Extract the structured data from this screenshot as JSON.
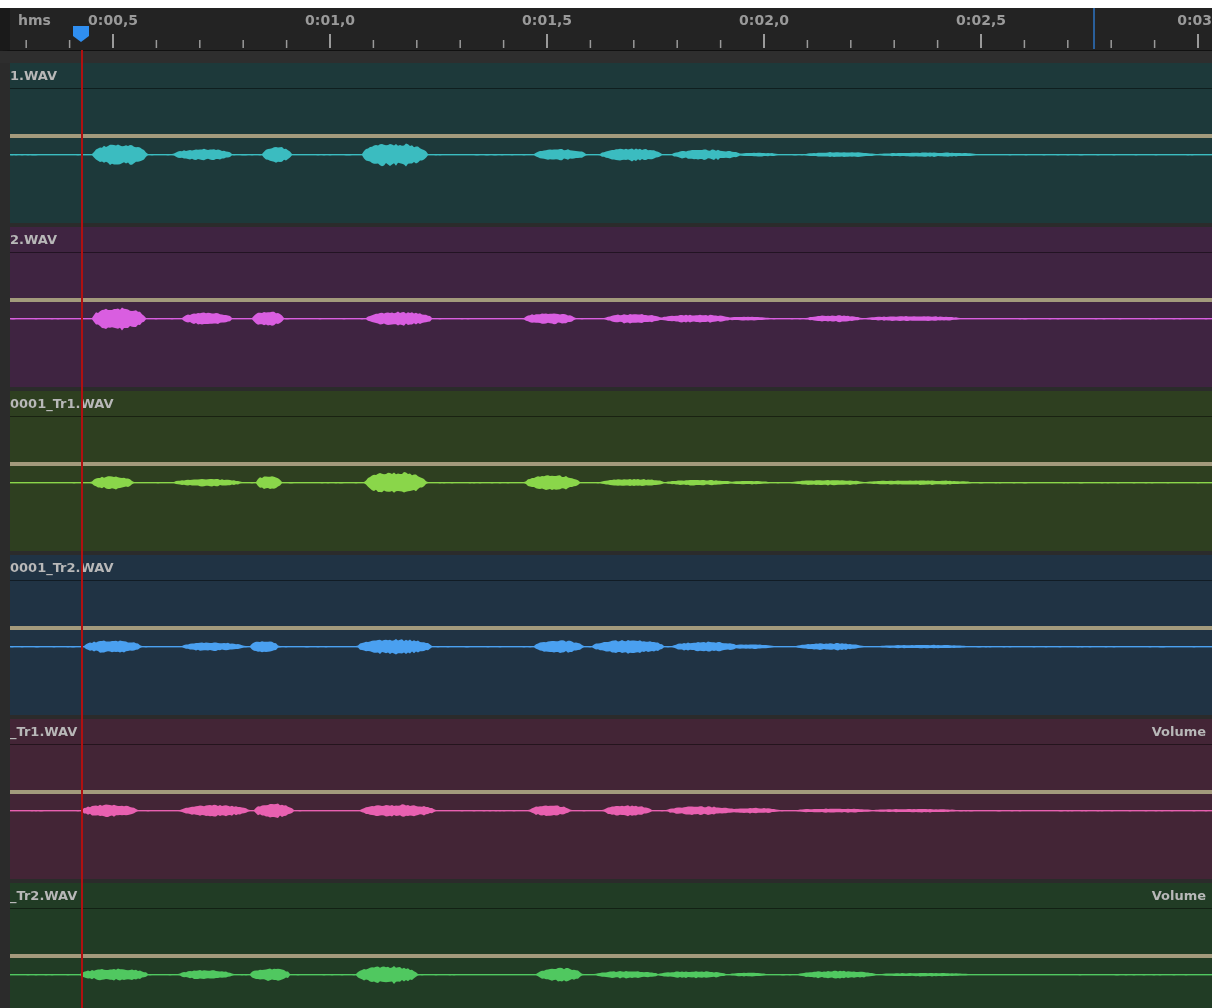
{
  "ruler": {
    "unit": "hms",
    "labels": [
      "0:00,5",
      "0:01,0",
      "0:01,5",
      "0:02,0",
      "0:02,5",
      "0:03"
    ]
  },
  "tracks": [
    {
      "name": "1.WAV",
      "color": "#3bbcc0"
    },
    {
      "name": "2.WAV",
      "color": "#d95ee0"
    },
    {
      "name": "0001_Tr1.WAV",
      "color": "#8ad64a"
    },
    {
      "name": "0001_Tr2.WAV",
      "color": "#4aa0f0"
    },
    {
      "name": "_Tr1.WAV",
      "color": "#e860b0",
      "volume_label": "Volume"
    },
    {
      "name": "_Tr2.WAV",
      "color": "#50c860",
      "volume_label": "Volume"
    }
  ]
}
